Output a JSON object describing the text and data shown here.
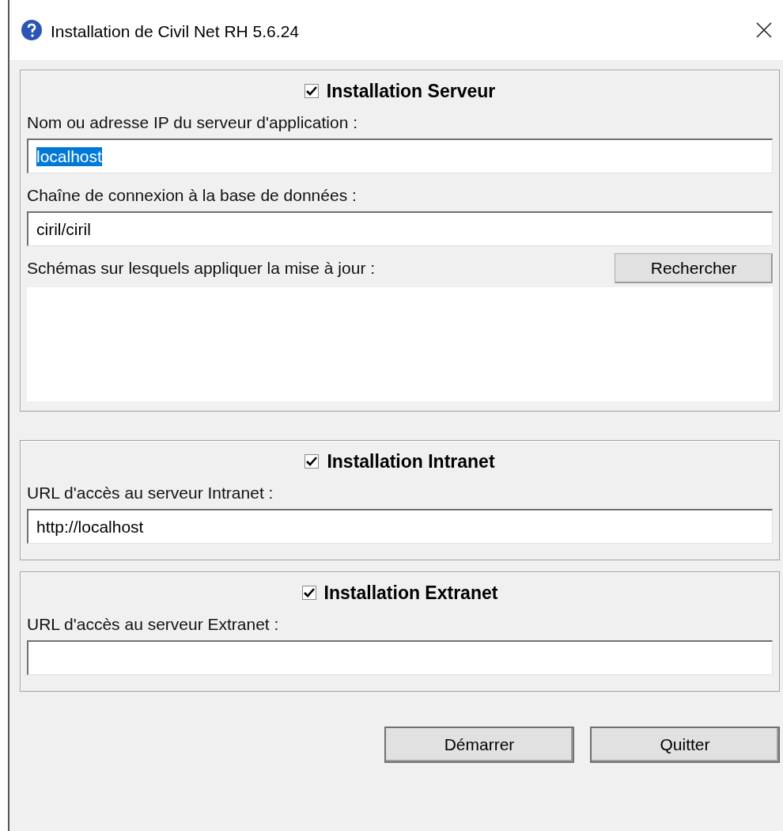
{
  "window": {
    "title": "Installation de Civil Net RH 5.6.24"
  },
  "sections": [
    {
      "title": "Installation Serveur",
      "checked": true,
      "fields": [
        {
          "kind": "text",
          "label": "Nom ou adresse IP du serveur d'application :",
          "value": "localhost",
          "selected": true
        },
        {
          "kind": "text",
          "label": "Chaîne de connexion à la base de données :",
          "value": "ciril/ciril",
          "selected": false
        },
        {
          "kind": "list",
          "label": "Schémas sur lesquels appliquer la mise à jour :",
          "button": "Rechercher"
        }
      ]
    },
    {
      "title": "Installation Intranet",
      "checked": true,
      "fields": [
        {
          "kind": "text",
          "label": "URL d'accès au serveur Intranet :",
          "value": "http://localhost",
          "selected": false
        }
      ]
    },
    {
      "title": "Installation Extranet",
      "checked": true,
      "fields": [
        {
          "kind": "text",
          "label": "URL d'accès au serveur Extranet :"
        }
      ]
    }
  ],
  "buttons": [
    "Démarrer",
    "Quitter"
  ]
}
